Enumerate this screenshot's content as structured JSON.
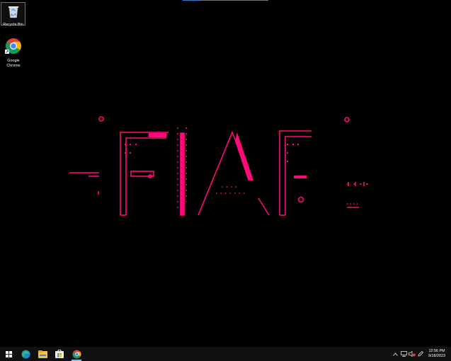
{
  "desktop": {
    "icons": [
      {
        "label": "Recycle Bin"
      },
      {
        "label": "Google Chrome"
      }
    ],
    "wallpaper": {
      "brand_text": "FIAP",
      "accent_color": "#ff0a78"
    }
  },
  "taskbar": {
    "items": [
      {
        "icon": "windows-start-icon"
      },
      {
        "icon": "edge-icon"
      },
      {
        "icon": "file-explorer-icon"
      },
      {
        "icon": "store-icon"
      },
      {
        "icon": "chrome-icon"
      }
    ],
    "tray": {
      "icons": [
        "chevron-up-icon",
        "network-icon",
        "volume-muted-icon",
        "pen-icon"
      ],
      "time": "12:56 PM",
      "date": "9/18/2023"
    }
  }
}
